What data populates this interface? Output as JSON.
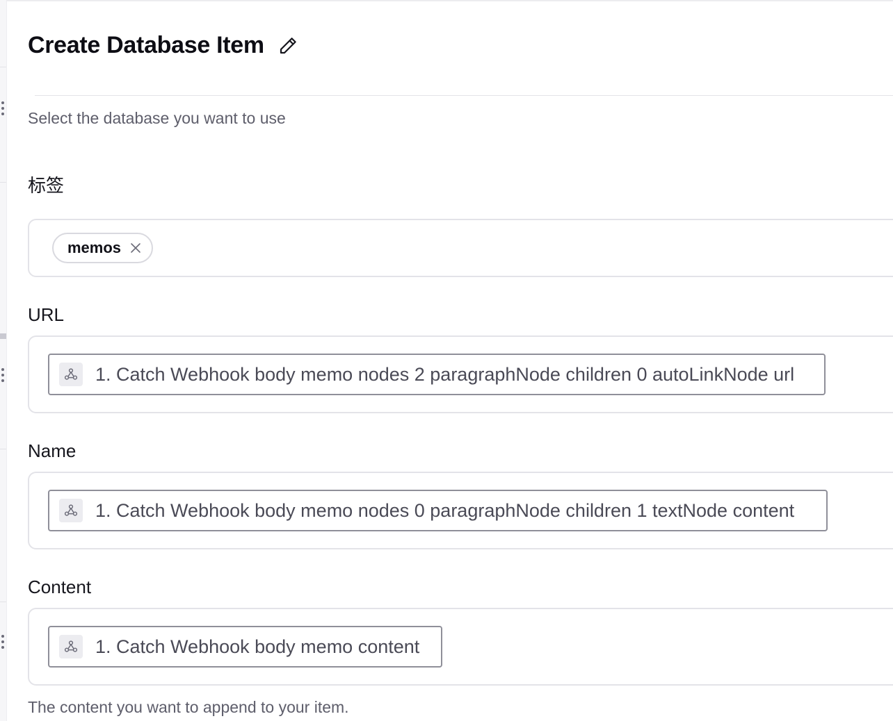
{
  "header": {
    "title": "Create Database Item",
    "edit_icon": "pencil-icon"
  },
  "database_help": "Select the database you want to use",
  "fields": {
    "tags": {
      "label": "标签",
      "chips": [
        {
          "label": "memos",
          "remove_icon": "close-icon"
        }
      ]
    },
    "url": {
      "label": "URL",
      "token": {
        "icon": "webhook-icon",
        "text": "1. Catch Webhook body memo nodes 2 paragraphNode children 0 autoLinkNode url"
      }
    },
    "name": {
      "label": "Name",
      "token": {
        "icon": "webhook-icon",
        "text": "1. Catch Webhook body memo nodes 0 paragraphNode children 1 textNode content"
      }
    },
    "content": {
      "label": "Content",
      "token": {
        "icon": "webhook-icon",
        "text": "1. Catch Webhook body memo content"
      },
      "help": "The content you want to append to your item."
    }
  },
  "colors": {
    "text_primary": "#16161d",
    "text_muted": "#5e5e6b",
    "border": "#e3e3e8",
    "token_border": "#8f8f99"
  }
}
